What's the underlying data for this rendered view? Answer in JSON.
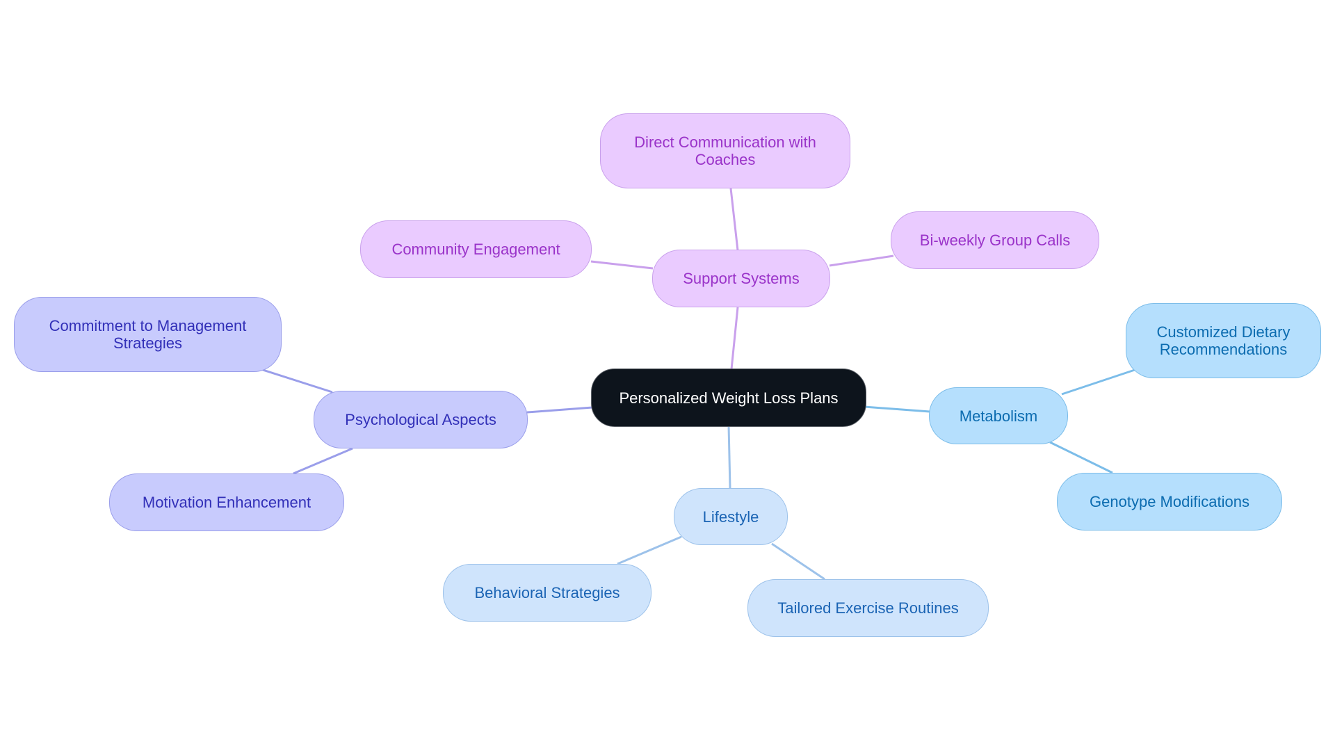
{
  "diagram": {
    "type": "mindmap",
    "root": {
      "id": "root",
      "label": "Personalized Weight Loss Plans"
    },
    "branches": [
      {
        "id": "support",
        "label": "Support Systems",
        "color": "#c9a0ec",
        "children": [
          {
            "id": "direct",
            "label": "Direct Communication with Coaches"
          },
          {
            "id": "community",
            "label": "Community Engagement"
          },
          {
            "id": "biweekly",
            "label": "Bi-weekly Group Calls"
          }
        ]
      },
      {
        "id": "psych",
        "label": "Psychological Aspects",
        "color": "#9a9eea",
        "children": [
          {
            "id": "commitment",
            "label": "Commitment to Management Strategies"
          },
          {
            "id": "motivation",
            "label": "Motivation Enhancement"
          }
        ]
      },
      {
        "id": "metabolism",
        "label": "Metabolism",
        "color": "#7cbde9",
        "children": [
          {
            "id": "dietary",
            "label": "Customized Dietary Recommendations"
          },
          {
            "id": "genotype",
            "label": "Genotype Modifications"
          }
        ]
      },
      {
        "id": "lifestyle",
        "label": "Lifestyle",
        "color": "#9dc2ea",
        "children": [
          {
            "id": "behavioral",
            "label": "Behavioral Strategies"
          },
          {
            "id": "exercise",
            "label": "Tailored Exercise Routines"
          }
        ]
      }
    ]
  },
  "labels": {
    "root": "Personalized Weight Loss Plans",
    "support": "Support Systems",
    "direct": "Direct Communication with Coaches",
    "community": "Community Engagement",
    "biweekly": "Bi-weekly Group Calls",
    "psych": "Psychological Aspects",
    "commitment": "Commitment to Management Strategies",
    "motivation": "Motivation Enhancement",
    "metabolism": "Metabolism",
    "dietary": "Customized Dietary Recommendations",
    "genotype": "Genotype Modifications",
    "lifestyle": "Lifestyle",
    "behavioral": "Behavioral Strategies",
    "exercise": "Tailored Exercise Routines"
  },
  "edge_colors": {
    "support": "#c9a0ec",
    "psych": "#9a9eea",
    "metabolism": "#7cbde9",
    "lifestyle": "#9dc2ea"
  }
}
